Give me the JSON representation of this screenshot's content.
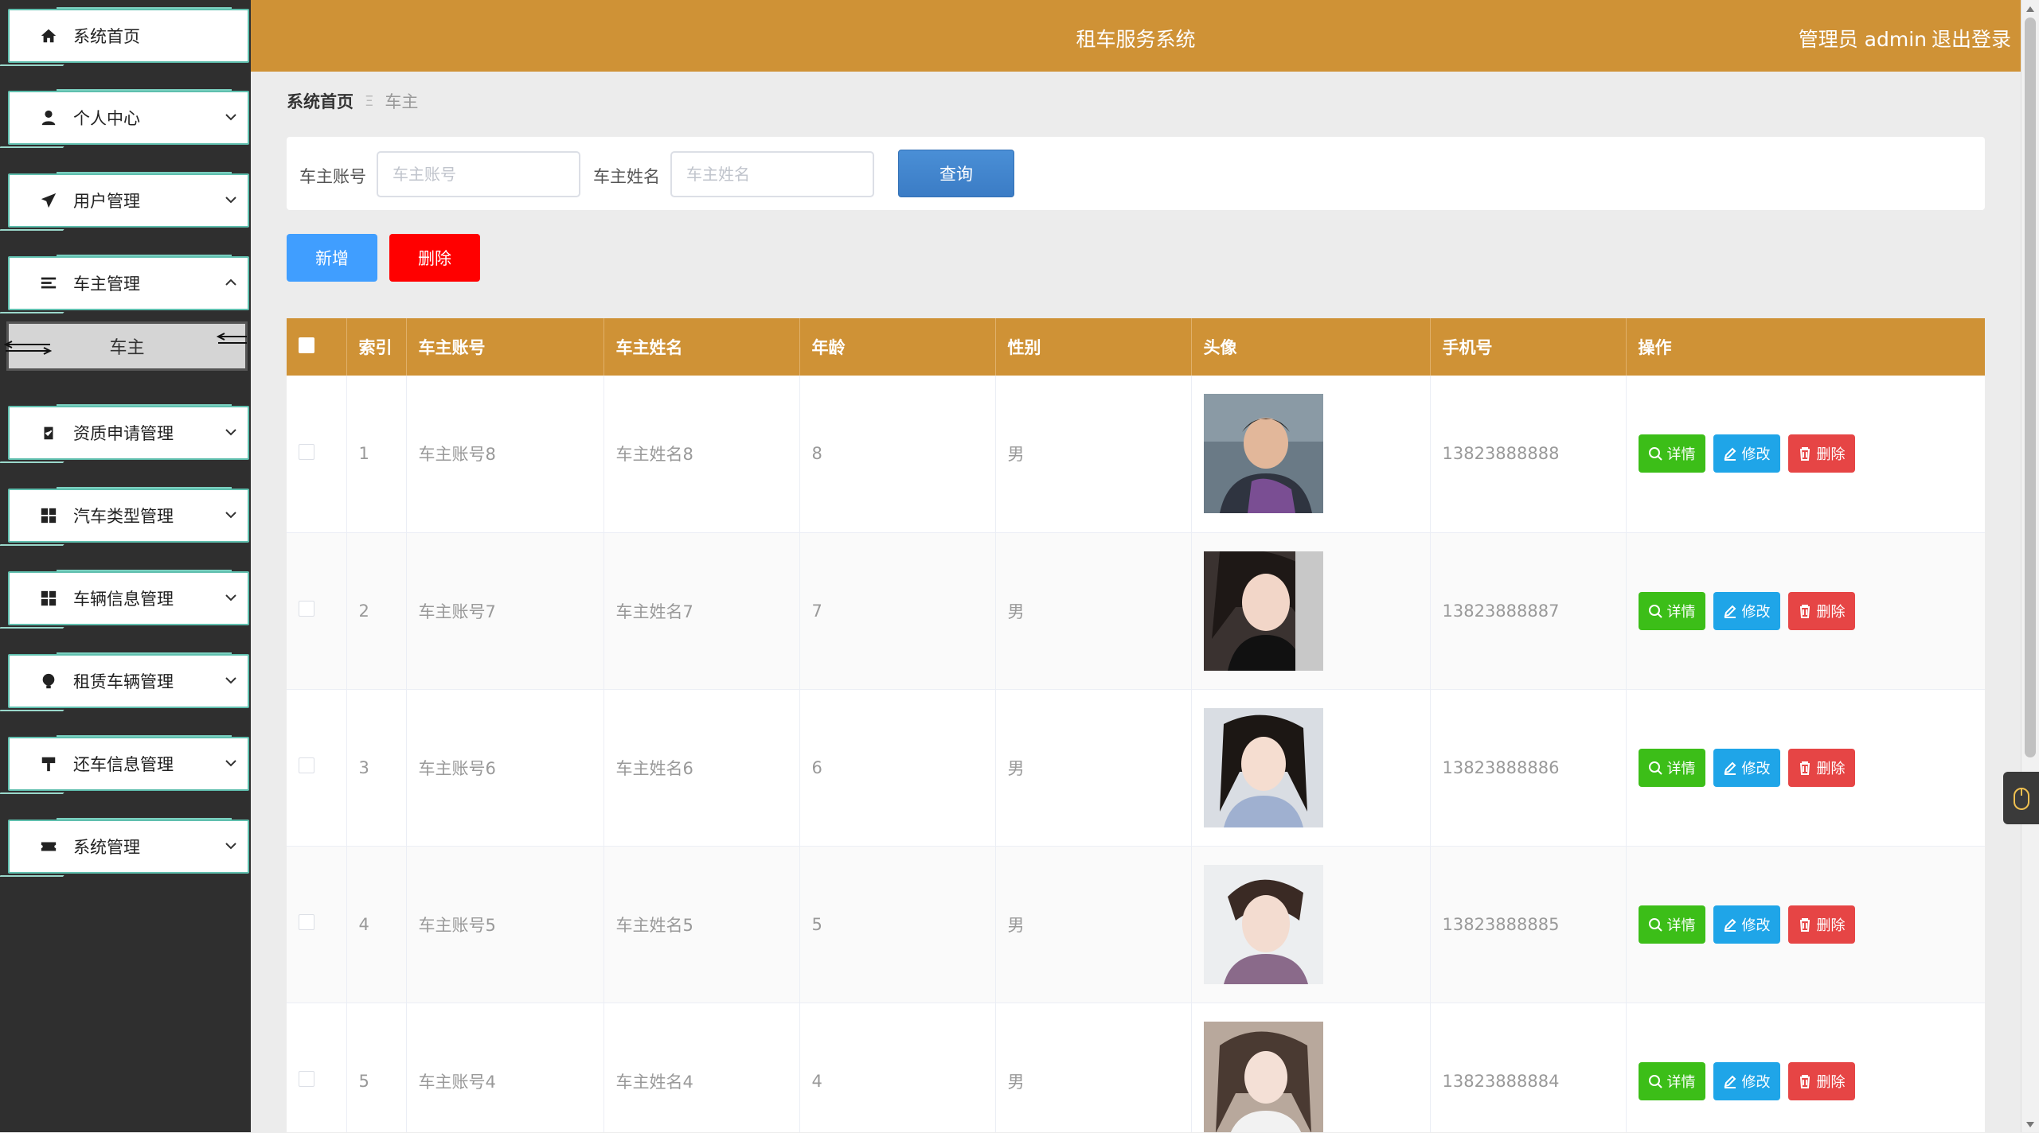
{
  "header": {
    "title": "租车服务系统",
    "user": "管理员 admin",
    "logout": "退出登录",
    "color": "#cf9236"
  },
  "sidebar": {
    "items": [
      {
        "label": "系统首页",
        "icon": "home-icon",
        "chevron": "none"
      },
      {
        "label": "个人中心",
        "icon": "user-icon",
        "chevron": "down"
      },
      {
        "label": "用户管理",
        "icon": "send-icon",
        "chevron": "down"
      },
      {
        "label": "车主管理",
        "icon": "list-icon",
        "chevron": "up"
      },
      {
        "label": "资质申请管理",
        "icon": "clipboard-icon",
        "chevron": "down"
      },
      {
        "label": "汽车类型管理",
        "icon": "grid-icon",
        "chevron": "down"
      },
      {
        "label": "车辆信息管理",
        "icon": "grid-icon",
        "chevron": "down"
      },
      {
        "label": "租赁车辆管理",
        "icon": "bulb-icon",
        "chevron": "down"
      },
      {
        "label": "还车信息管理",
        "icon": "sign-icon",
        "chevron": "down"
      },
      {
        "label": "系统管理",
        "icon": "ticket-icon",
        "chevron": "down"
      }
    ],
    "submenu": {
      "label": "车主"
    }
  },
  "breadcrumb": {
    "home": "系统首页",
    "separator": "Ξ",
    "current": "车主"
  },
  "search": {
    "account_label": "车主账号",
    "account_placeholder": "车主账号",
    "name_label": "车主姓名",
    "name_placeholder": "车主姓名",
    "query_button": "查询"
  },
  "actions": {
    "add": "新增",
    "delete": "删除"
  },
  "table": {
    "columns": [
      "索引",
      "车主账号",
      "车主姓名",
      "年龄",
      "性别",
      "头像",
      "手机号",
      "操作"
    ],
    "rows": [
      {
        "index": "1",
        "account": "车主账号8",
        "name": "车主姓名8",
        "age": "8",
        "gender": "男",
        "phone": "13823888888"
      },
      {
        "index": "2",
        "account": "车主账号7",
        "name": "车主姓名7",
        "age": "7",
        "gender": "男",
        "phone": "13823888887"
      },
      {
        "index": "3",
        "account": "车主账号6",
        "name": "车主姓名6",
        "age": "6",
        "gender": "男",
        "phone": "13823888886"
      },
      {
        "index": "4",
        "account": "车主账号5",
        "name": "车主姓名5",
        "age": "5",
        "gender": "男",
        "phone": "13823888885"
      },
      {
        "index": "5",
        "account": "车主账号4",
        "name": "车主姓名4",
        "age": "4",
        "gender": "男",
        "phone": "13823888884"
      }
    ],
    "ops": {
      "detail": "详情",
      "edit": "修改",
      "delete": "删除"
    }
  },
  "colors": {
    "primary": "#409eff",
    "danger": "#ff0000",
    "success": "#3cbe18",
    "info": "#1fa5e8",
    "warn": "#e64545"
  }
}
